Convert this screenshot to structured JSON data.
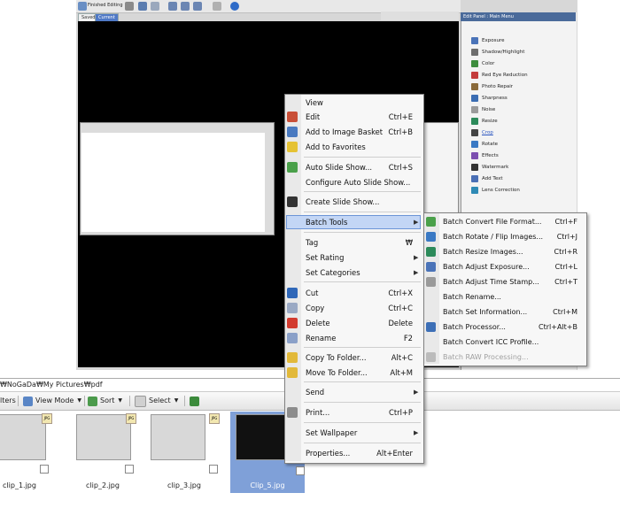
{
  "editor": {
    "finished_label": "Finished Editing",
    "tab_saved": "Saved",
    "tab_current": "Current",
    "panel_title": "Edit Panel : Main Menu",
    "panel_items": [
      "Exposure",
      "Shadow/Highlight",
      "Color",
      "Red Eye Reduction",
      "Photo Repair",
      "Sharpness",
      "Noise",
      "Resize",
      "Crop",
      "Rotate",
      "Effects",
      "Watermark",
      "Add Text",
      "Lens Correction"
    ]
  },
  "pathbar": {
    "path": "₩NoGaDa₩My Pictures₩pdf"
  },
  "toolbar": {
    "filters": "lters",
    "view_mode": "View Mode",
    "sort": "Sort",
    "select": "Select"
  },
  "thumbnails": [
    {
      "caption": "clip_1.jpg"
    },
    {
      "caption": "clip_2.jpg"
    },
    {
      "caption": "clip_3.jpg"
    },
    {
      "caption": "Clip_5.jpg"
    }
  ],
  "context_menu": {
    "view": "View",
    "edit": "Edit",
    "edit_sc": "Ctrl+E",
    "add_basket": "Add to Image Basket",
    "add_basket_sc": "Ctrl+B",
    "add_fav": "Add to Favorites",
    "auto_slide": "Auto Slide Show...",
    "auto_slide_sc": "Ctrl+S",
    "config_slide": "Configure Auto Slide Show...",
    "create_slide": "Create Slide Show...",
    "batch_tools": "Batch Tools",
    "tag": "Tag",
    "tag_sc": "₩",
    "set_rating": "Set Rating",
    "set_categories": "Set Categories",
    "cut": "Cut",
    "cut_sc": "Ctrl+X",
    "copy": "Copy",
    "copy_sc": "Ctrl+C",
    "delete": "Delete",
    "delete_sc": "Delete",
    "rename": "Rename",
    "rename_sc": "F2",
    "copy_folder": "Copy To Folder...",
    "copy_folder_sc": "Alt+C",
    "move_folder": "Move To Folder...",
    "move_folder_sc": "Alt+M",
    "send": "Send",
    "print": "Print...",
    "print_sc": "Ctrl+P",
    "set_wallpaper": "Set Wallpaper",
    "properties": "Properties...",
    "properties_sc": "Alt+Enter"
  },
  "batch_submenu": {
    "convert": "Batch Convert File Format...",
    "convert_sc": "Ctrl+F",
    "rotate": "Batch Rotate / Flip Images...",
    "rotate_sc": "Ctrl+J",
    "resize": "Batch Resize Images...",
    "resize_sc": "Ctrl+R",
    "exposure": "Batch Adjust Exposure...",
    "exposure_sc": "Ctrl+L",
    "timestamp": "Batch Adjust Time Stamp...",
    "timestamp_sc": "Ctrl+T",
    "rename": "Batch Rename...",
    "setinfo": "Batch Set Information...",
    "setinfo_sc": "Ctrl+M",
    "processor": "Batch Processor...",
    "processor_sc": "Ctrl+Alt+B",
    "icc": "Batch Convert ICC Profile...",
    "raw": "Batch RAW Processing..."
  },
  "colors": {
    "accent": "#6c95d7",
    "highlight": "#c3d6f5",
    "selection": "#7fa0d8"
  }
}
